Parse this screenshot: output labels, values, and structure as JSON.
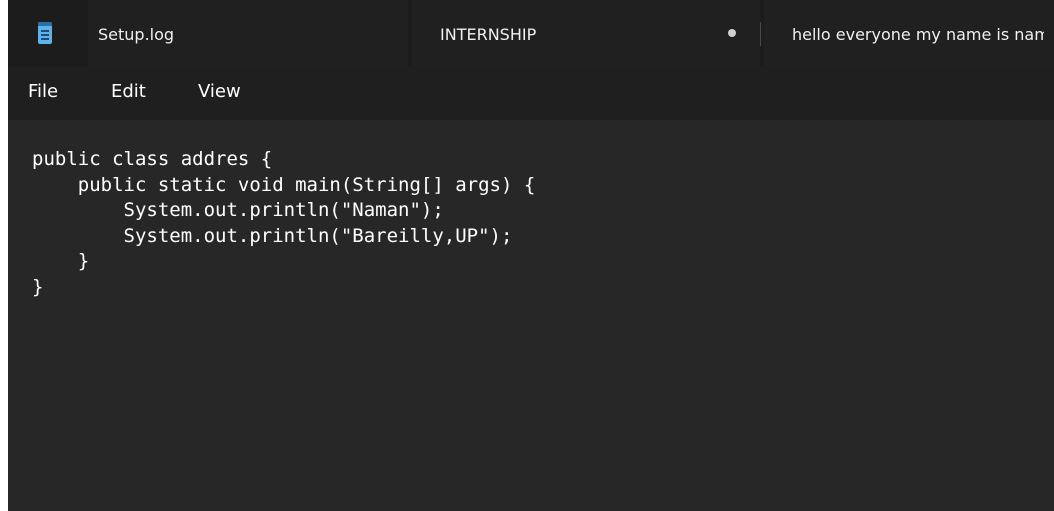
{
  "tabs": [
    {
      "title": "Setup.log"
    },
    {
      "title": "INTERNSHIP",
      "modified": true
    },
    {
      "title": "hello everyone my name is naman"
    }
  ],
  "app_icon": "notepad-icon",
  "menu": {
    "file": "File",
    "edit": "Edit",
    "view": "View"
  },
  "editor": {
    "lines": [
      "public class addres {",
      "    public static void main(String[] args) {",
      "        System.out.println(\"Naman\");",
      "        System.out.println(\"Bareilly,UP\");",
      "    }",
      "}"
    ]
  },
  "colors": {
    "tab_bar": "#1c1c1c",
    "editor_background": "#272727",
    "text": "#ffffff"
  }
}
